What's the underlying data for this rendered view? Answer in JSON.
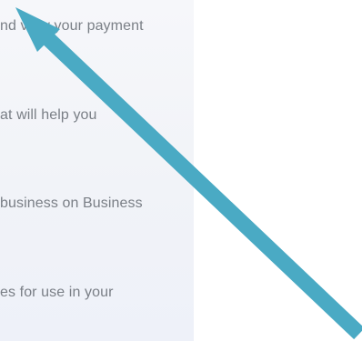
{
  "left_panel": {
    "lines": [
      "nd view your payment",
      "at will help you",
      "business on Business",
      "es for use in your"
    ]
  },
  "annotation": {
    "arrow_color": "#4aaac4",
    "arrow_direction": "up-left",
    "icon": "arrow-icon"
  }
}
